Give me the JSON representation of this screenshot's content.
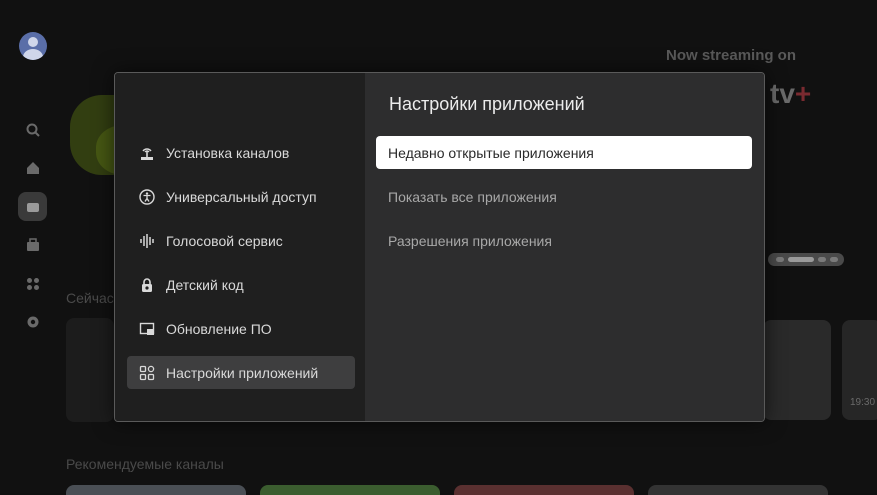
{
  "background": {
    "banner": {
      "streaming_label": "Now streaming on",
      "brand": "tv",
      "brand_plus": "+"
    },
    "rows": [
      {
        "title": "Сейчас"
      },
      {
        "title": "Рекомендуемые каналы"
      }
    ],
    "thumb_time": "19:30"
  },
  "dialog": {
    "menu": [
      {
        "label": "Установка каналов",
        "icon": "antenna-icon"
      },
      {
        "label": "Универсальный доступ",
        "icon": "accessibility-icon"
      },
      {
        "label": "Голосовой сервис",
        "icon": "voice-wave-icon"
      },
      {
        "label": "Детский код",
        "icon": "lock-icon"
      },
      {
        "label": "Обновление ПО",
        "icon": "software-update-icon"
      },
      {
        "label": "Настройки приложений",
        "icon": "apps-icon",
        "selected": true
      }
    ],
    "panel": {
      "title": "Настройки приложений",
      "options": [
        {
          "label": "Недавно открытые приложения",
          "focused": true
        },
        {
          "label": "Показать все приложения"
        },
        {
          "label": "Разрешения приложения"
        }
      ]
    }
  },
  "colors": {
    "focus_bg": "#ffffff",
    "selected_bg": "#3e3e3f",
    "left_panel_bg": "#1f1f1f",
    "right_panel_bg": "#2d2d2e"
  }
}
